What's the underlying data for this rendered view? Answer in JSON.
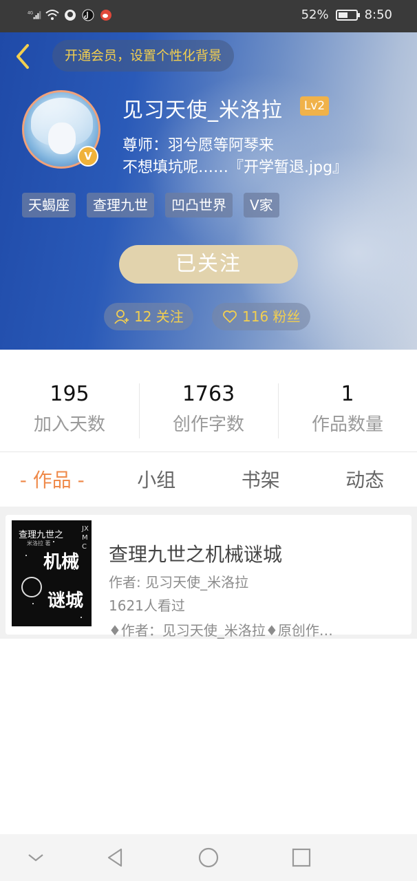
{
  "status_bar": {
    "network": "4G",
    "battery_percent": "52%",
    "time": "8:50",
    "icons": [
      "signal-icon",
      "wifi-icon",
      "app-notification-icon",
      "tiktok-icon",
      "weibo-icon",
      "battery-icon"
    ]
  },
  "header": {
    "vip_promo": "开通会员，设置个性化背景",
    "username": "见习天使_米洛拉",
    "level": "Lv2",
    "verified_mark": "V",
    "mentor": "尊师：羽兮愿等阿琴来",
    "bio": "不想填坑呢……『开学暂退.jpg』",
    "tags": [
      "天蝎座",
      "查理九世",
      "凹凸世界",
      "V家"
    ],
    "follow_button": "已关注",
    "following": "12 关注",
    "fans": "116 粉丝",
    "colors": {
      "accent_gold": "#f3cf4f",
      "avatar_border": "#f1a27a",
      "follow_button": "#e2d3ad"
    }
  },
  "stats": [
    {
      "value": "195",
      "label": "加入天数"
    },
    {
      "value": "1763",
      "label": "创作字数"
    },
    {
      "value": "1",
      "label": "作品数量"
    }
  ],
  "tabs": [
    {
      "label": "- 作品 -",
      "active": true
    },
    {
      "label": "小组",
      "active": false
    },
    {
      "label": "书架",
      "active": false
    },
    {
      "label": "动态",
      "active": false
    }
  ],
  "works": [
    {
      "title": "查理九世之机械谜城",
      "author": "作者: 见习天使_米洛拉",
      "views": "1621人看过",
      "description": "♦作者：见习天使_米洛拉♦原创作…",
      "cover": {
        "series": "查理九世之",
        "sub": "米洛拉 著",
        "big_line1": "机械",
        "big_line2": "谜城",
        "side": "JXMC"
      }
    }
  ],
  "colors": {
    "active_tab": "#ef8a4a",
    "header_blue": "#2a5ab8"
  }
}
